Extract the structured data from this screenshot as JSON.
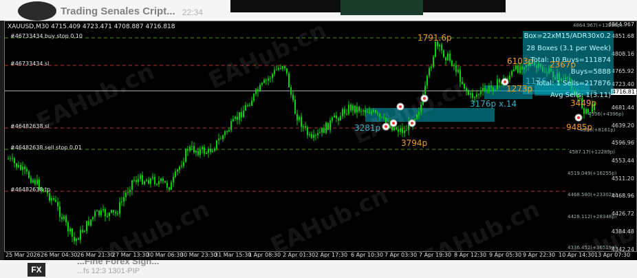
{
  "channel": {
    "name": "Trading Senales Cript...",
    "time": "22:34"
  },
  "chart": {
    "symbol_line": "XAUUSD,M30  4715.409 4723.471 4708.887 4716.818",
    "order_labels": [
      {
        "text": "#46733434 buy stop 0.10"
      },
      {
        "text": "#46733434 sl"
      },
      {
        "text": "#46482638 sl"
      },
      {
        "text": "#46482638 sell stop 0.01"
      },
      {
        "text": "#46482638 tp"
      }
    ],
    "price_axis": [
      "4864.967",
      "4851.68",
      "4808.16",
      "4765.92",
      "4723.40",
      "4716.81",
      "4681.44",
      "4639.20",
      "4596.96",
      "4553.44",
      "4511.20",
      "4468.96",
      "4426.72",
      "4384.48",
      "4342.24"
    ],
    "right_notes": [
      "4864.967(+13298p)",
      "4536(+4396p)",
      "4586(+8161p)",
      "4587.17(+12289p)",
      "4519.049(+16255p)",
      "4468.580(+23302p)",
      "4428.112(+28348p)",
      "4336.452(+36519p)"
    ],
    "time_axis": [
      "25 Mar 2026",
      "26 Mar 04:30",
      "26 Mar 21:30",
      "27 Mar 13:30",
      "30 Mar 06:30",
      "30 Mar 23:30",
      "31 Mar 15:30",
      "1 Apr 08:30",
      "2 Apr 01:30",
      "2 Apr 17:30",
      "6 Apr 10:30",
      "7 Apr 03:30",
      "7 Apr 19:30",
      "8 Apr 12:30",
      "9 Apr 05:30",
      "9 Apr 22:30",
      "10 Apr 14:30",
      "13 Apr 07:30"
    ],
    "annotations": {
      "a1": "1791.6p",
      "a2": "6103p",
      "a3": "2367p",
      "a4": "3281p",
      "a5": "3794p",
      "a6": "3176p x.14",
      "a7": "1273p",
      "a8": "1176",
      "a9": "3449p",
      "a10": "9485p"
    },
    "stats": [
      "Box=22xM15/ADR30x0.2",
      "28 Boxes (3.1 per Week)",
      "Total: 10 Buys=111874",
      "Buys=5888",
      "Total: 1 Sells=217876",
      "Avg Sells: 1(3.11)"
    ],
    "watermark": "EAHub.cn",
    "colors": {
      "candle": "#00d400",
      "box": "#00a9bd",
      "orange": "#f39c25"
    }
  },
  "bottom": {
    "badge": "FX",
    "title": "...Fine Forex Sign...",
    "sub": "...fs 12:3 1301-PIP"
  }
}
